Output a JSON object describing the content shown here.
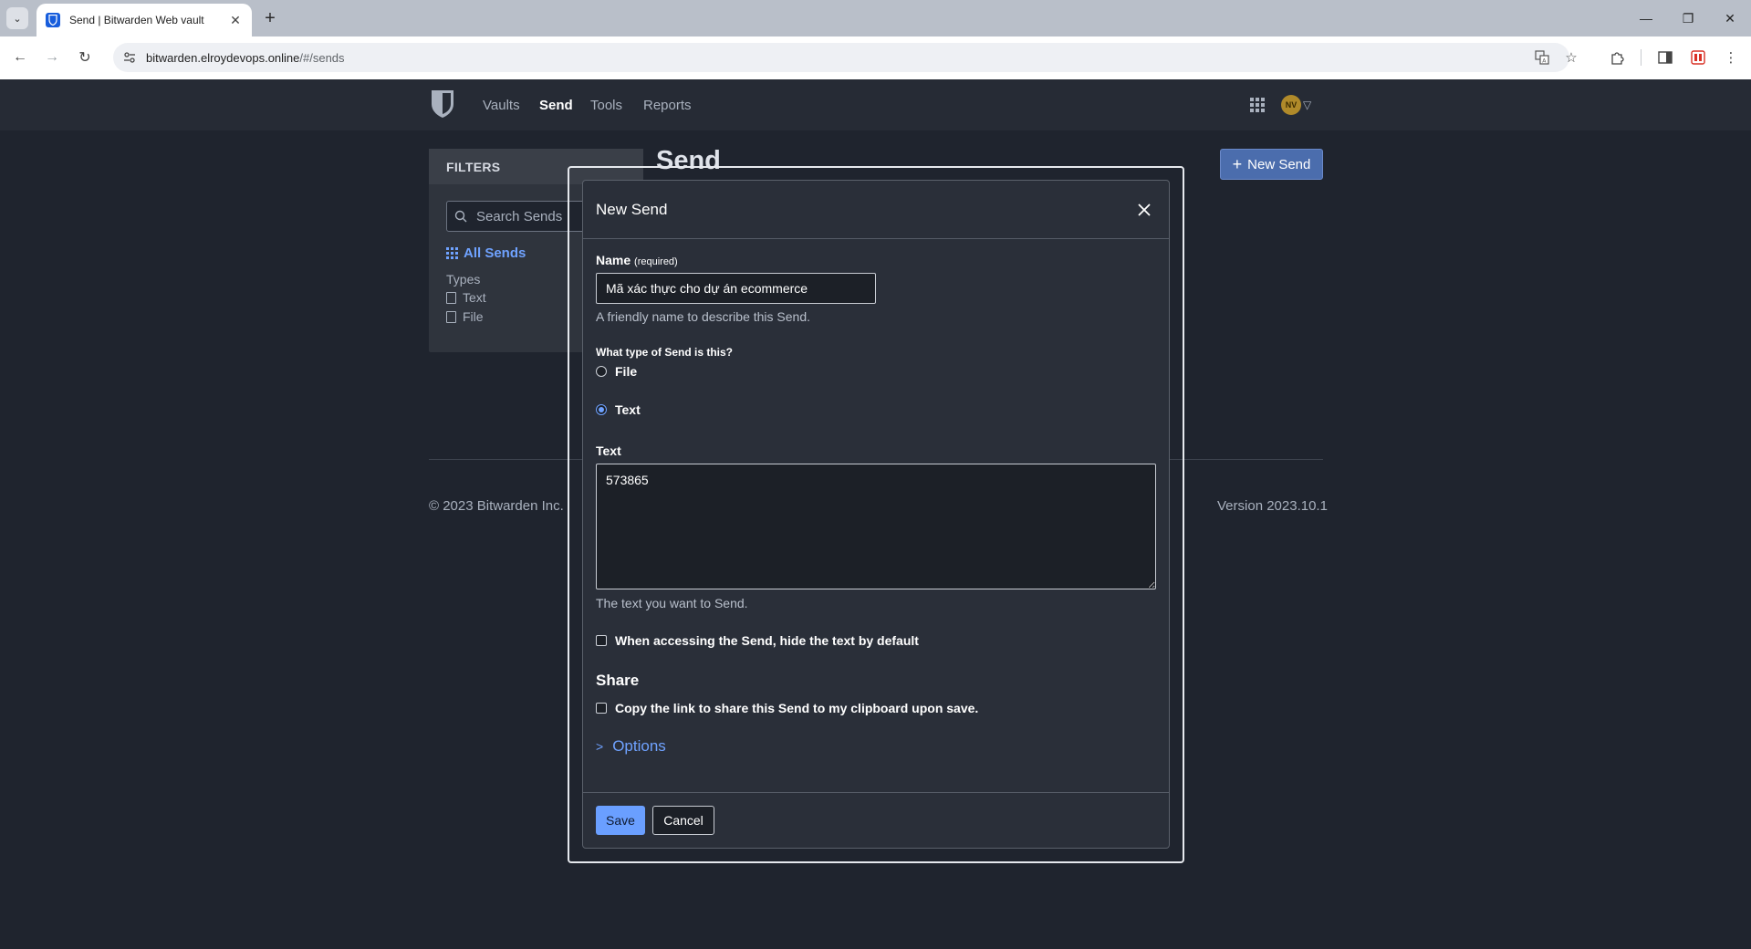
{
  "browser": {
    "tab_title": "Send | Bitwarden Web vault",
    "url_host": "bitwarden.elroydevops.online",
    "url_path": "/#/sends"
  },
  "nav": {
    "links": [
      "Vaults",
      "Send",
      "Tools",
      "Reports"
    ],
    "active": "Send",
    "avatar_initials": "NV"
  },
  "filters": {
    "title": "FILTERS",
    "search_placeholder": "Search Sends",
    "all_label": "All Sends",
    "types_label": "Types",
    "types": [
      "Text",
      "File"
    ]
  },
  "page": {
    "title": "Send",
    "new_send_label": "New Send"
  },
  "footer": {
    "copyright": "© 2023 Bitwarden Inc.",
    "version": "Version 2023.10.1"
  },
  "modal": {
    "title": "New Send",
    "name_label": "Name",
    "name_required": "(required)",
    "name_value": "Mã xác thực cho dự án ecommerce",
    "name_hint": "A friendly name to describe this Send.",
    "type_question": "What type of Send is this?",
    "type_options": [
      "File",
      "Text"
    ],
    "type_selected": "Text",
    "text_label": "Text",
    "text_value": "573865",
    "text_hint": "The text you want to Send.",
    "hide_text_label": "When accessing the Send, hide the text by default",
    "share_heading": "Share",
    "copy_link_label": "Copy the link to share this Send to my clipboard upon save.",
    "options_label": "Options",
    "save_label": "Save",
    "cancel_label": "Cancel"
  },
  "colors": {
    "accent": "#6fa2ff",
    "background": "#1f242e",
    "modal_bg": "#2a2f39",
    "nav_bg": "#262b35"
  }
}
